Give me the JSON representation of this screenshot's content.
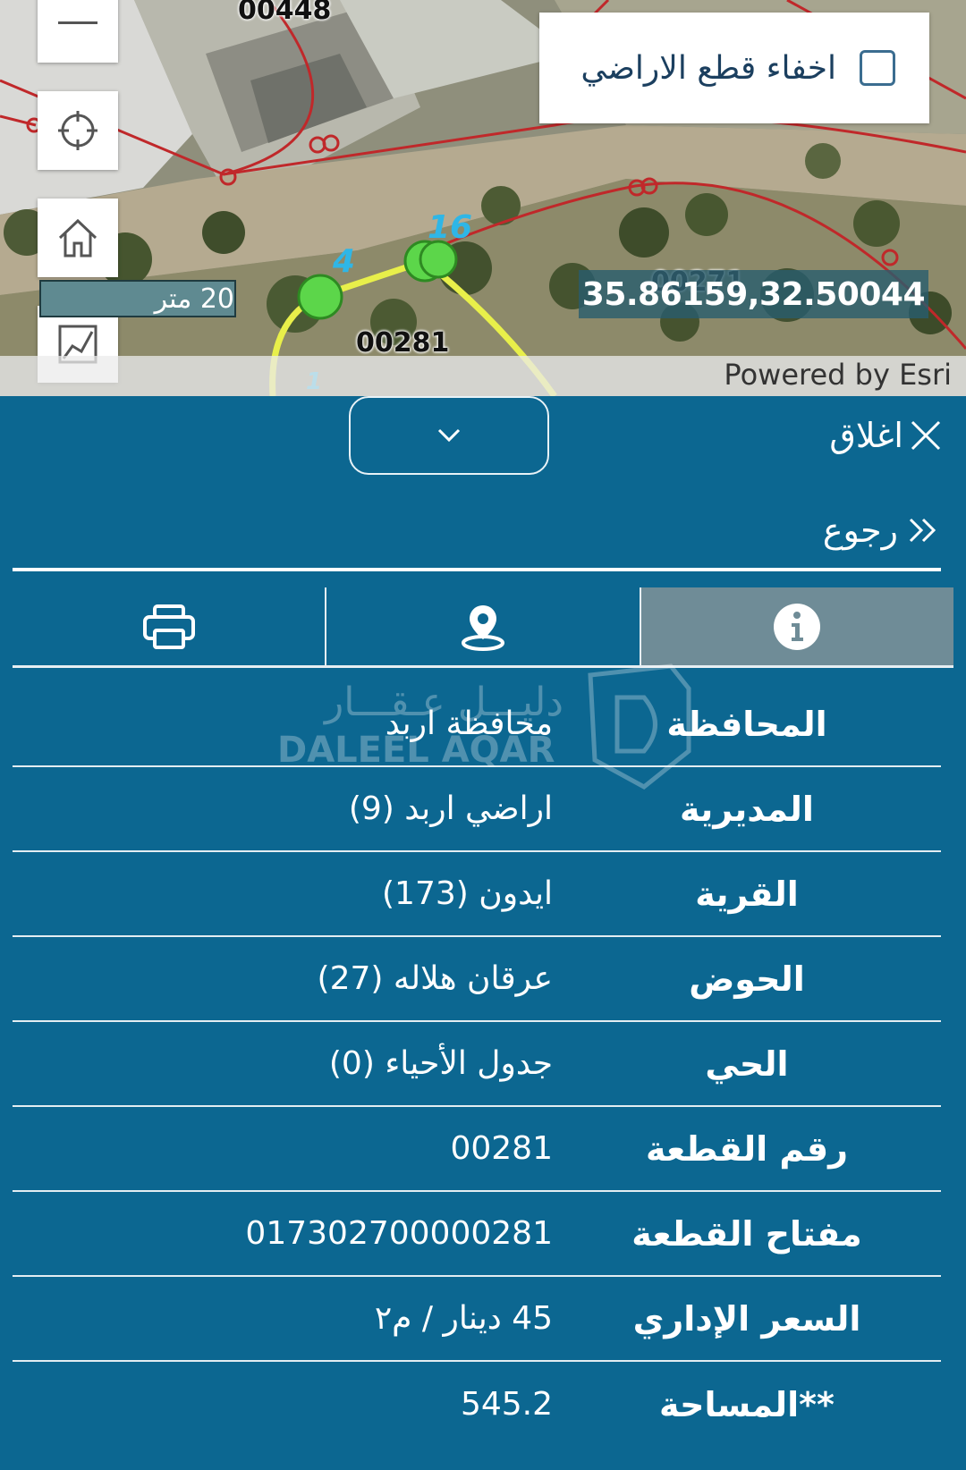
{
  "map": {
    "plot_labels": {
      "top": "00448",
      "center": "00281",
      "right": "00271"
    },
    "point_labels": {
      "p4": "4",
      "p16": "16",
      "p1": "1"
    },
    "scale_text": "20 متر",
    "coordinates": "35.86159,32.50044",
    "attribution": "Powered by Esri",
    "hide_parcels_label": "اخفاء قطع الاراضي",
    "controls": [
      "zoom-out-icon",
      "locate-icon",
      "home-icon",
      "measure-icon"
    ],
    "colors": {
      "parcel_line": "#c0282a",
      "selection_line": "#e8ef4a",
      "point_fill": "#5cd64a"
    }
  },
  "panel": {
    "close_label": "اغلاق",
    "back_label": "رجوع",
    "tabs": [
      {
        "icon": "info-icon",
        "active": true
      },
      {
        "icon": "location-pin-icon",
        "active": false
      },
      {
        "icon": "printer-icon",
        "active": false
      }
    ],
    "rows": [
      {
        "key": "المحافظة",
        "value": "محافظة اربد"
      },
      {
        "key": "المديرية",
        "value": "اراضي اربد (9)"
      },
      {
        "key": "القرية",
        "value": "ايدون (173)"
      },
      {
        "key": "الحوض",
        "value": "عرقان هلاله (27)"
      },
      {
        "key": "الحي",
        "value": "جدول الأحياء (0)"
      },
      {
        "key": "رقم القطعة",
        "value": "00281"
      },
      {
        "key": "مفتاح القطعة",
        "value": "017302700000281"
      },
      {
        "key": "السعر الإداري",
        "value": "45 دينار / م٢"
      },
      {
        "key": "**المساحة",
        "value": "545.2"
      }
    ],
    "colors": {
      "background": "#0c6791",
      "active_tab": "#6f8c97"
    }
  },
  "watermark": {
    "arabic": "دليـــل عـقـــار",
    "latin": "DALEEL AQAR"
  }
}
